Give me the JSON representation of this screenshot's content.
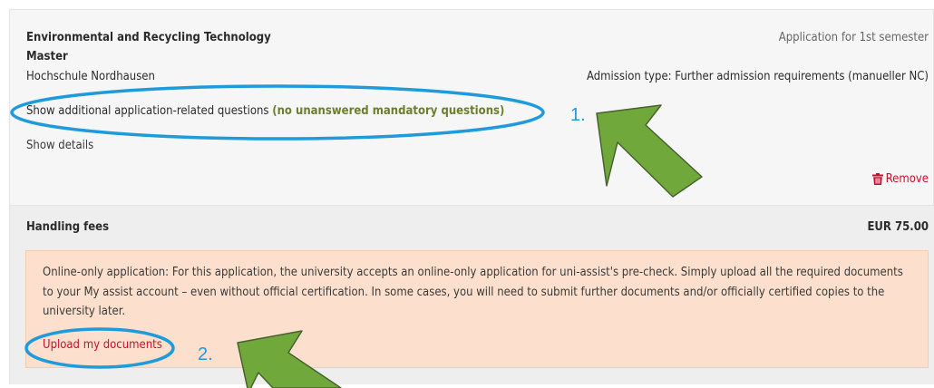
{
  "program": {
    "title": "Environmental and Recycling Technology",
    "degree": "Master",
    "university": "Hochschule Nordhausen",
    "semester": "Application for 1st semester",
    "admission_type": "Admission type: Further admission requirements (manueller NC)",
    "questions_link": "Show additional application-related questions",
    "questions_hint": "(no unanswered mandatory questions)",
    "details_link": "Show details",
    "remove_label": "Remove"
  },
  "fees": {
    "title": "Handling fees",
    "amount": "EUR 75.00"
  },
  "notice": {
    "text": "Online-only application: For this application, the university accepts an online-only application for uni-assist's pre-check. Simply upload all the required documents to your My assist account – even without official certification. In some cases, you will need to submit further documents and/or officially certified copies to the university later.",
    "upload_link": "Upload my documents"
  },
  "annotations": {
    "marker_1": "1.",
    "marker_2": "2.",
    "ellipse_color": "#1f9bdb",
    "arrow_color": "#70a83c"
  },
  "colors": {
    "card_bg": "#f6f6f6",
    "hint_green": "#6b7e2e",
    "remove_red": "#c8102e",
    "notice_bg": "#fce0cd"
  },
  "icons": {
    "remove": "trash-icon"
  }
}
